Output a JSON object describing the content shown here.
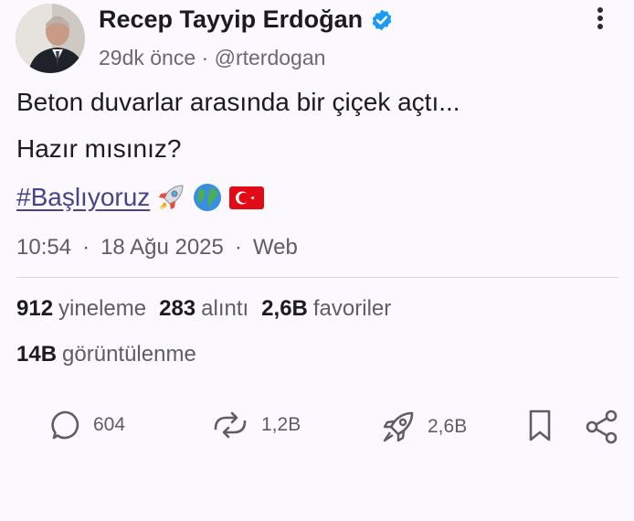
{
  "post": {
    "author": {
      "display_name": "Recep Tayyip Erdoğan",
      "handle": "@rterdogan",
      "relative_time": "29dk önce",
      "separator": "·",
      "verified": true
    },
    "text_lines": [
      "Beton duvarlar arasında bir çiçek açtı...",
      "Hazır mısınız?"
    ],
    "hashtag": "#Başlıyoruz",
    "emojis": [
      "rocket-emoji",
      "globe-emoji",
      "turkey-flag-emoji"
    ],
    "time": "10:54",
    "date": "18 Ağu 2025",
    "source": "Web",
    "dot": "·"
  },
  "stats": {
    "reposts": {
      "count": "912",
      "label": "yineleme"
    },
    "quotes": {
      "count": "283",
      "label": "alıntı"
    },
    "favorites": {
      "count": "2,6B",
      "label": "favoriler"
    },
    "views": {
      "count": "14B",
      "label": "görüntülenme"
    }
  },
  "actions": {
    "reply_count": "604",
    "repost_count": "1,2B",
    "favorite_count": "2,6B"
  },
  "colors": {
    "background": "#fcf9fe",
    "hashtag": "#4a4486",
    "verified": "#1d9bf0",
    "flag_red": "#e30a17"
  },
  "icons": [
    "verified-badge-icon",
    "more-vertical-icon",
    "reply-icon",
    "repost-icon",
    "rocket-favorite-icon",
    "bookmark-icon",
    "share-icon"
  ]
}
